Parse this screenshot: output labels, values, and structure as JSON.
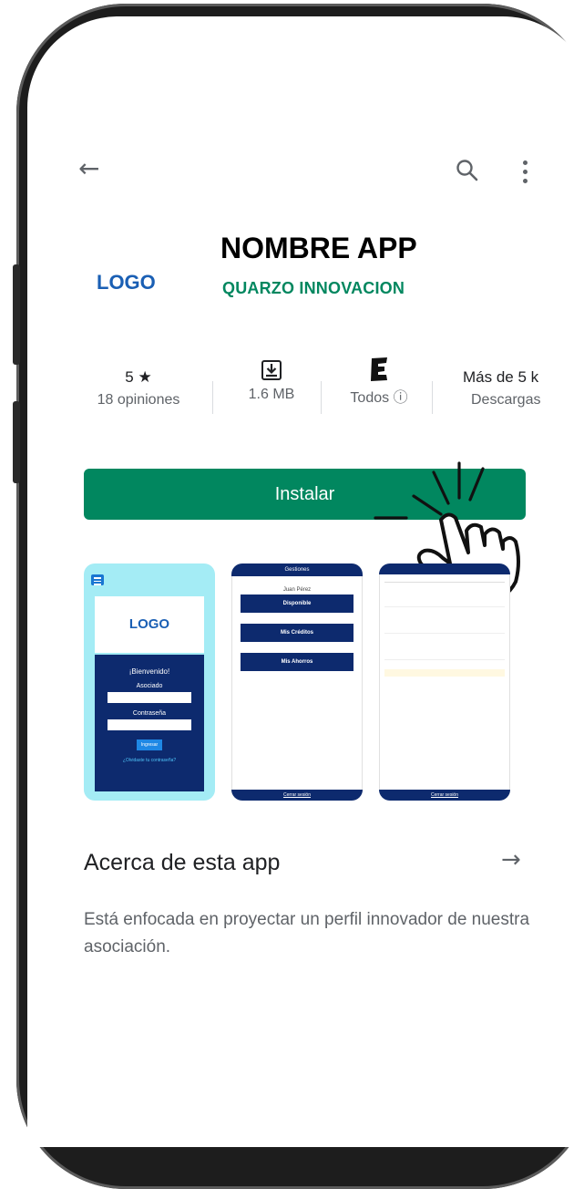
{
  "toolbar": {
    "back_icon": "arrow-left-icon",
    "search_icon": "search-icon",
    "more_icon": "more-vert-icon"
  },
  "app": {
    "logo": "LOGO",
    "name": "NOMBRE APP",
    "developer": "QUARZO INNOVACION"
  },
  "stats": {
    "rating": "5 ★",
    "reviews": "18 opiniones",
    "size": "1.6 MB",
    "content_rating": "Todos ⓘ",
    "downloads_top": "Más de 5 k",
    "downloads_label": "Descargas"
  },
  "install_label": "Instalar",
  "screenshots": {
    "s1": {
      "logo": "LOGO",
      "welcome": "¡Bienvenido!",
      "user_label": "Asociado",
      "pass_label": "Contraseña",
      "login_button": "Ingresar",
      "forgot": "¿Olvidaste tu contraseña?"
    },
    "s2": {
      "header": "Gestiones",
      "user": "Juan Pérez",
      "btn1": "Disponible",
      "btn2": "Mis Créditos",
      "btn3": "Mis Ahorros",
      "footer": "Cerrar sesión"
    },
    "s3": {
      "footer": "Cerrar sesión"
    }
  },
  "about": {
    "title": "Acerca de esta app",
    "arrow_icon": "arrow-right-icon",
    "text": "Está enfocada en proyectar un perfil innovador de nuestra asociación."
  },
  "colors": {
    "accent": "#01875f",
    "logo": "#1a5fb4",
    "navy": "#0d2a6e",
    "cyan": "#a4ecf5"
  }
}
